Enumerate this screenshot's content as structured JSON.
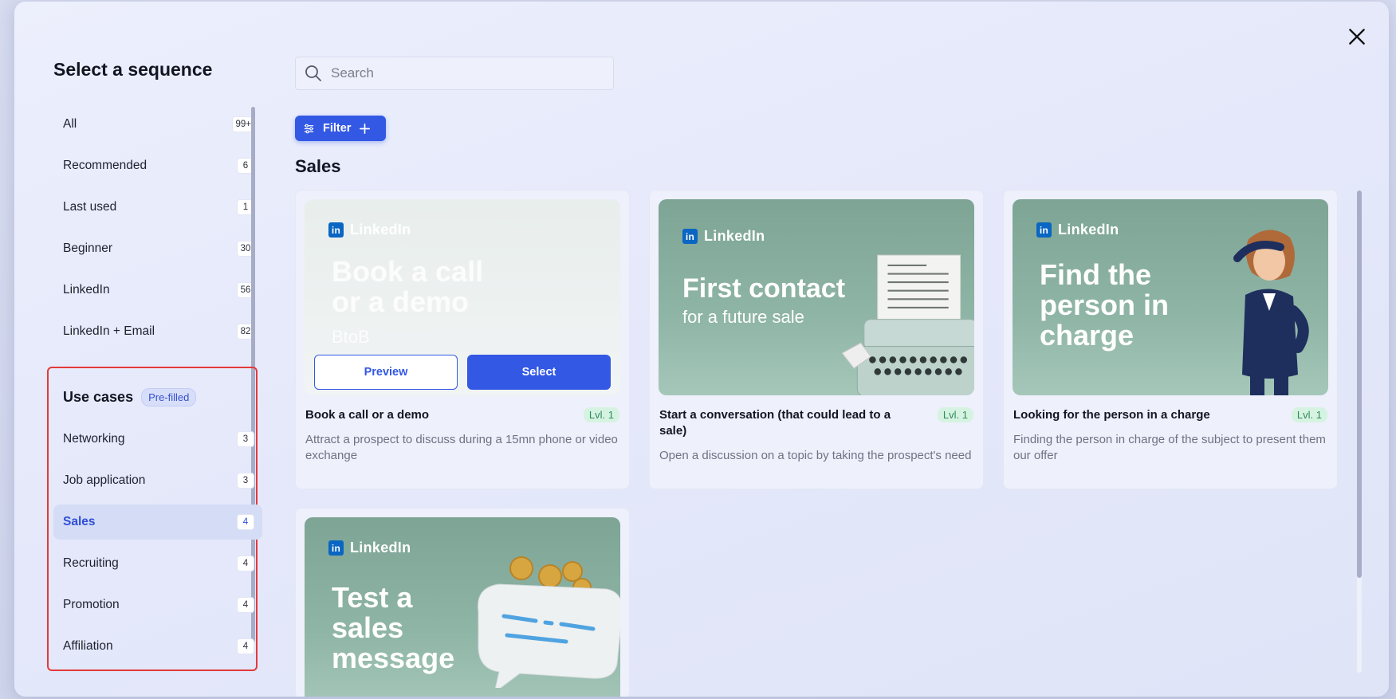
{
  "modal": {
    "title": "Select a sequence",
    "close_icon": "close-icon"
  },
  "sidebar": {
    "items": [
      {
        "label": "All",
        "count": "99+"
      },
      {
        "label": "Recommended",
        "count": "6"
      },
      {
        "label": "Last used",
        "count": "1"
      },
      {
        "label": "Beginner",
        "count": "30"
      },
      {
        "label": "LinkedIn",
        "count": "56"
      },
      {
        "label": "LinkedIn + Email",
        "count": "82"
      }
    ],
    "use_cases": {
      "title": "Use cases",
      "badge": "Pre-filled",
      "items": [
        {
          "label": "Networking",
          "count": "3"
        },
        {
          "label": "Job application",
          "count": "3"
        },
        {
          "label": "Sales",
          "count": "4",
          "active": true
        },
        {
          "label": "Recruiting",
          "count": "4"
        },
        {
          "label": "Promotion",
          "count": "4"
        },
        {
          "label": "Affiliation",
          "count": "4"
        }
      ]
    }
  },
  "search": {
    "placeholder": "Search",
    "value": ""
  },
  "filter": {
    "label": "Filter"
  },
  "section": {
    "title": "Sales"
  },
  "cards": [
    {
      "brand": "LinkedIn",
      "image_headline_1": "Book a call",
      "image_headline_2": "or a demo",
      "image_sub": "BtoB",
      "title": "Book a call or a demo",
      "level": "Lvl. 1",
      "description": "Attract a prospect to discuss during a 15mn phone or video exchange",
      "preview_label": "Preview",
      "select_label": "Select"
    },
    {
      "brand": "LinkedIn",
      "image_headline_1": "First contact",
      "image_sub": "for a future sale",
      "title": "Start a conversation (that could lead to a sale)",
      "level": "Lvl. 1",
      "description": "Open a discussion on a topic by taking the prospect's need"
    },
    {
      "brand": "LinkedIn",
      "image_headline_1": "Find the",
      "image_headline_2": "person in",
      "image_headline_3": "charge",
      "title": "Looking for the person in a charge",
      "level": "Lvl. 1",
      "description": "Finding the person in charge of the subject to present them our offer"
    },
    {
      "brand": "LinkedIn",
      "image_headline_1": "Test a",
      "image_headline_2": "sales",
      "image_headline_3": "message"
    }
  ],
  "colors": {
    "accent": "#3358e4",
    "highlight_border": "#e23a3a",
    "card_image": "#8fb5a6",
    "level_badge": "#d6f3e2"
  }
}
